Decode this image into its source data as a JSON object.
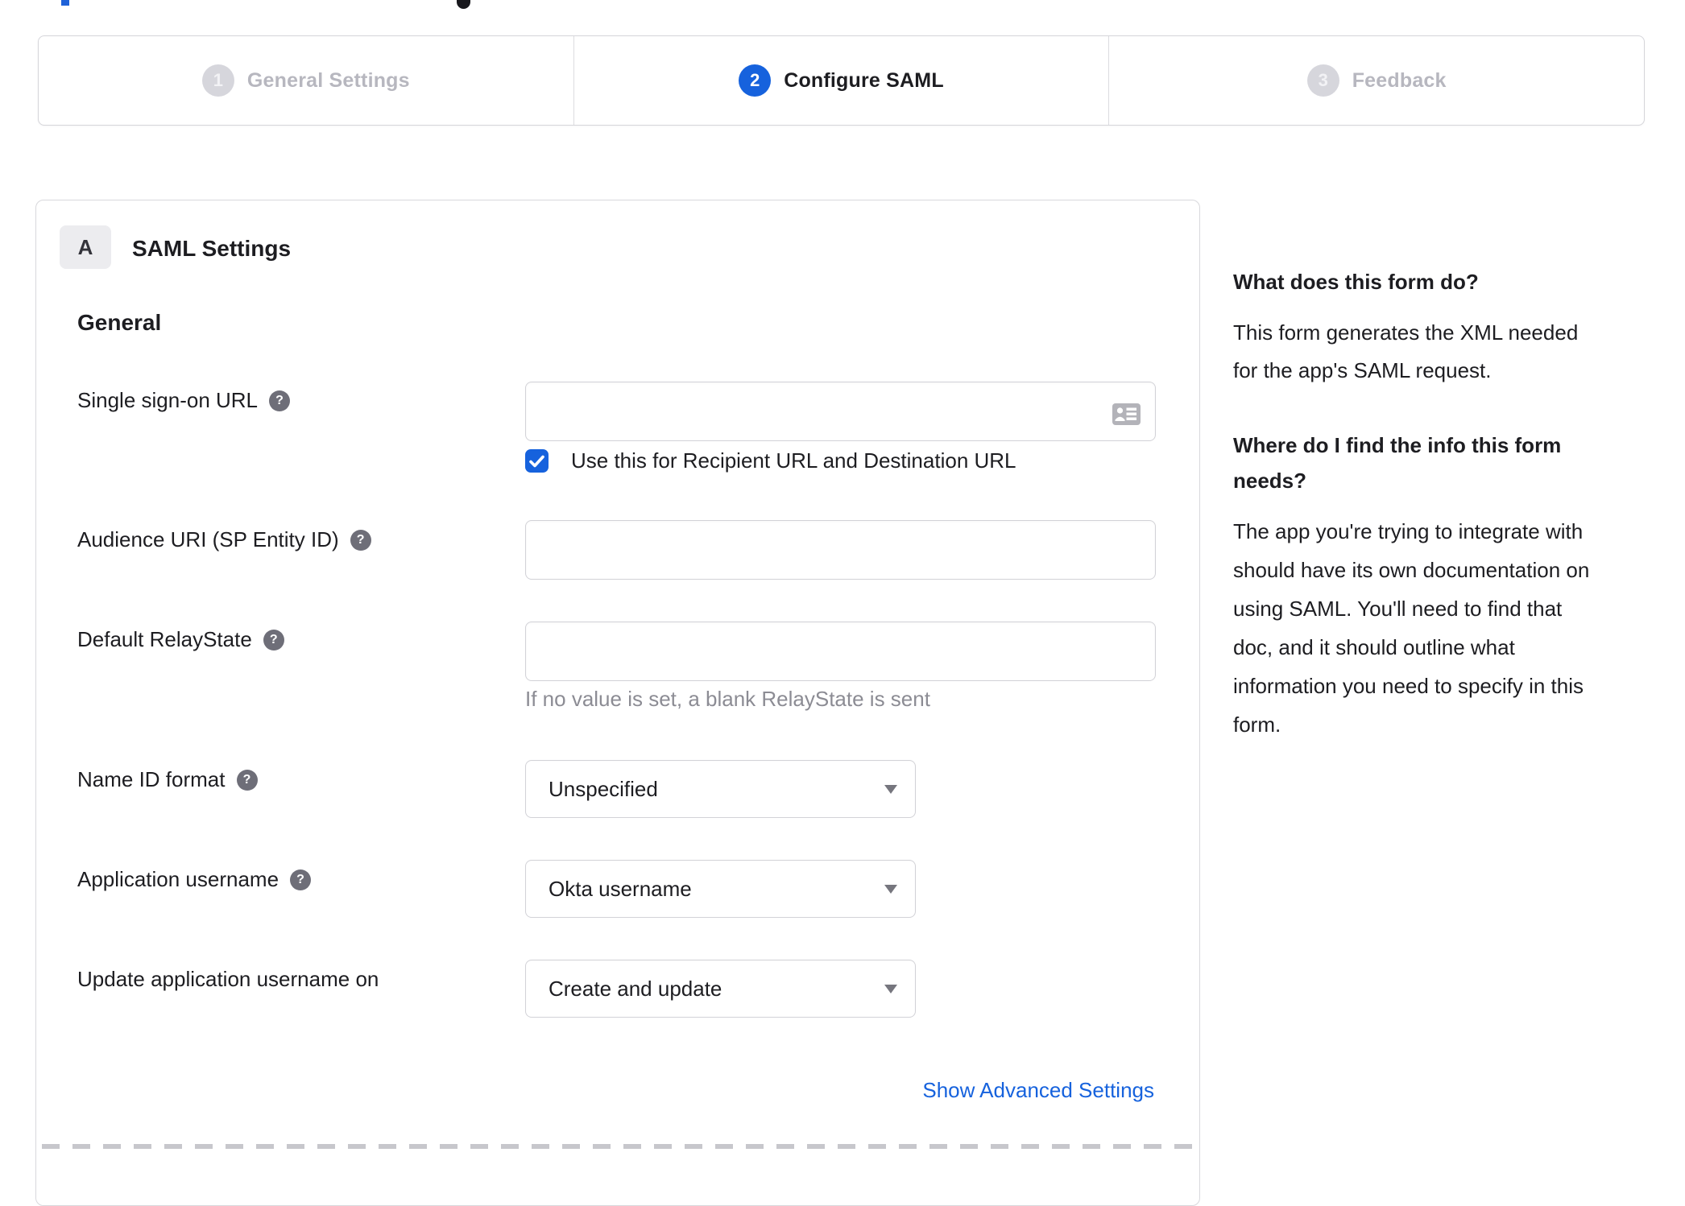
{
  "colors": {
    "accent": "#1662dd",
    "inactive_gray": "#b7b7bf"
  },
  "stepper": {
    "active_step": 2,
    "steps": [
      {
        "number": "1",
        "label": "General Settings"
      },
      {
        "number": "2",
        "label": "Configure SAML"
      },
      {
        "number": "3",
        "label": "Feedback"
      }
    ]
  },
  "panel": {
    "badge": "A",
    "title": "SAML Settings",
    "section_heading": "General",
    "sso": {
      "label": "Single sign-on URL",
      "value": "",
      "checkbox_label": "Use this for Recipient URL and Destination URL",
      "checkbox_checked": true
    },
    "audience": {
      "label": "Audience URI (SP Entity ID)",
      "value": ""
    },
    "relay_state": {
      "label": "Default RelayState",
      "value": "",
      "hint": "If no value is set, a blank RelayState is sent"
    },
    "name_id_format": {
      "label": "Name ID format",
      "value": "Unspecified"
    },
    "app_username": {
      "label": "Application username",
      "value": "Okta username"
    },
    "update_username": {
      "label": "Update application username on",
      "value": "Create and update"
    },
    "advanced_link": "Show Advanced Settings"
  },
  "sidebar": {
    "q1": "What does this form do?",
    "a1": "This form generates the XML needed\nfor the app's SAML request.",
    "q2": "Where do I find the info this form\nneeds?",
    "a2": "The app you're trying to integrate with\nshould have its own documentation on\nusing SAML. You'll need to find that\ndoc, and it should outline what\ninformation you need to specify in this\nform."
  }
}
